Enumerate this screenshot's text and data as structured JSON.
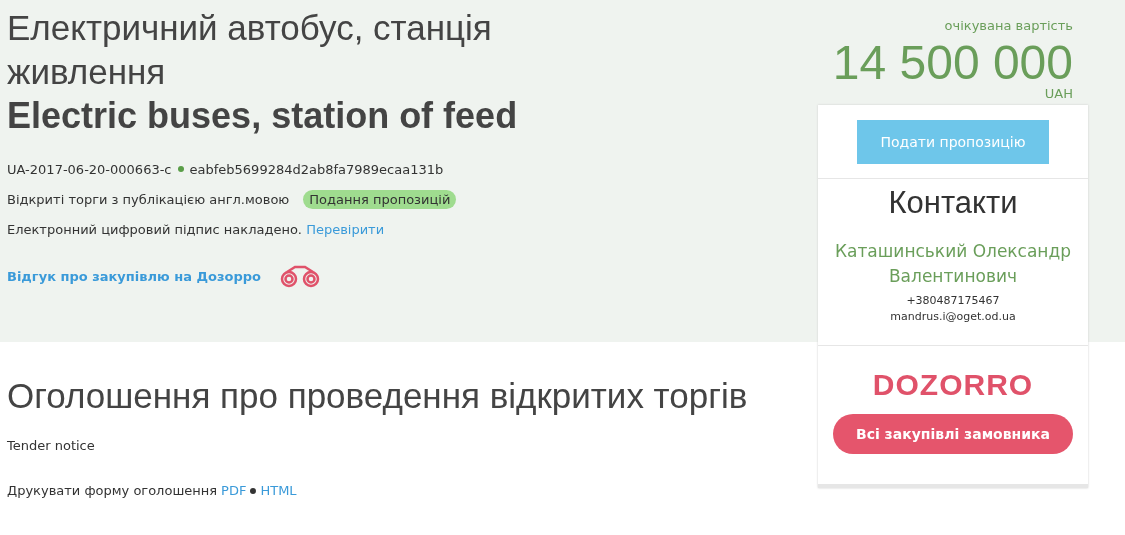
{
  "title_uk": "Електричний автобус, станція живлення",
  "title_en": "Electric buses, station of feed",
  "tender_id": "UA-2017-06-20-000663-c",
  "hash": "eabfeb5699284d2ab8fa7989ecaa131b",
  "procedure": "Відкриті торги з публікацією англ.мовою",
  "status_badge": "Подання пропозицій",
  "signature": {
    "text": "Електронний цифровий підпис накладено.",
    "link": "Перевірити"
  },
  "review_link": "Відгук про закупівлю на Дозорро",
  "price": {
    "label": "очікувана вартість",
    "amount": "14 500 000",
    "currency": "UAH"
  },
  "submit_button": "Подати пропозицію",
  "contacts": {
    "title": "Контакти",
    "name": "Каташинський Олександр Валентинович",
    "phone": "+380487175467",
    "email": "mandrus.i@oget.od.ua"
  },
  "dozorro_logo": "DOZORRO",
  "all_purchases_button": "Всі закупівлі замовника",
  "notice": {
    "heading": "Оголошення про проведення відкритих торгів",
    "subtitle": "Tender notice",
    "print_label": "Друкувати форму оголошення",
    "links": [
      "PDF",
      "HTML"
    ]
  }
}
